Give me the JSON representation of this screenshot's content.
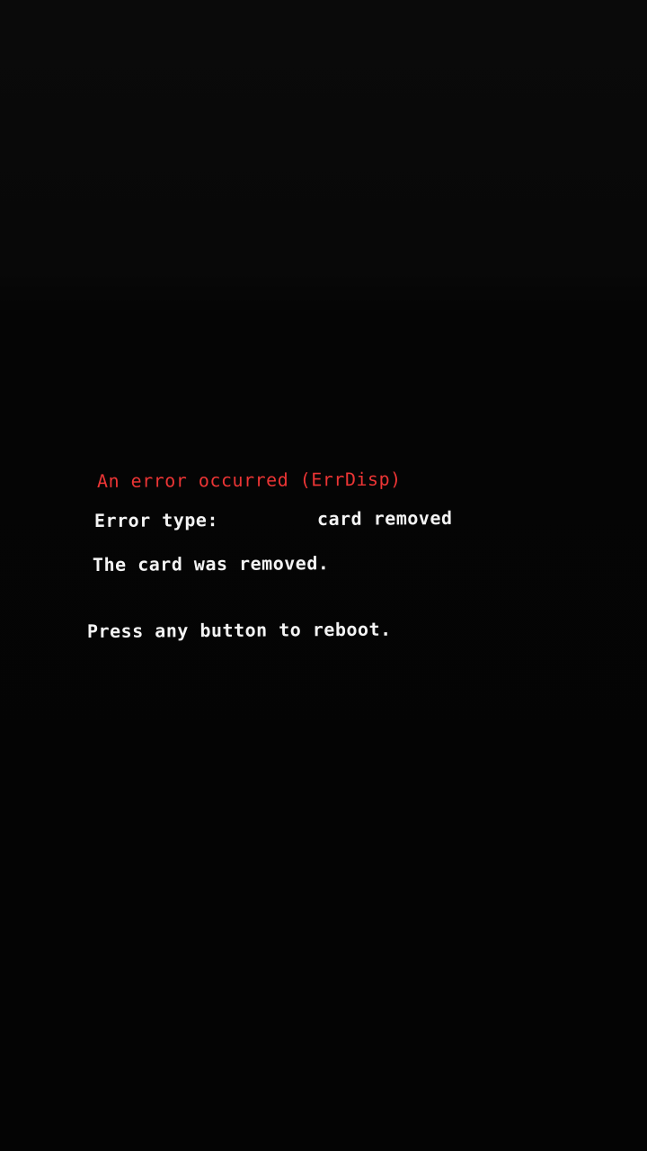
{
  "error": {
    "title": "An error occurred (ErrDisp)",
    "type_label": "Error type:",
    "type_value": "card removed",
    "message": "The card was removed.",
    "reboot_prompt": "Press any button to reboot."
  },
  "colors": {
    "background": "#040404",
    "title": "#ec3535",
    "text": "#f4f4f4"
  }
}
